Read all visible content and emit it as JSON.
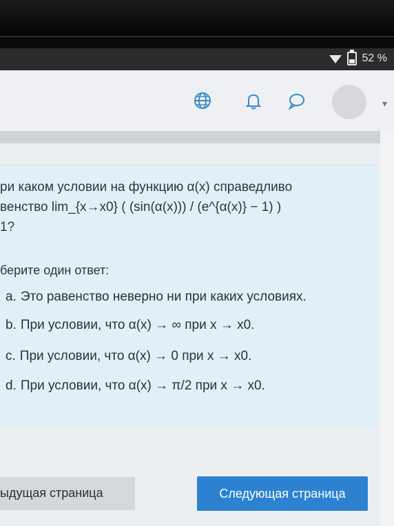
{
  "status_bar": {
    "battery_text": "52 %"
  },
  "header": {
    "icons": [
      "globe-icon",
      "bell-icon",
      "chat-icon",
      "avatar",
      "chevron-down-icon"
    ]
  },
  "question": {
    "lines": [
      "ри каком условии на функцию α(x) справедливо",
      "венство lim_{x→x0} ( (sin(α(x))) / (e^{α(x)} − 1) )",
      "1?"
    ],
    "prompt": "берите один ответ:",
    "options": [
      {
        "letter": "a.",
        "text": "Это равенство неверно ни при каких условиях."
      },
      {
        "letter": "b.",
        "text": "При условии, что α(x) → ∞ при x → x0."
      },
      {
        "letter": "c.",
        "text": "При условии, что α(x) → 0 при x → x0."
      },
      {
        "letter": "d.",
        "text": "При условии, что α(x) → π/2 при x → x0."
      }
    ]
  },
  "navigation": {
    "prev_label": "ыдущая страница",
    "next_label": "Следующая страница"
  },
  "colors": {
    "accent": "#2c82d0",
    "question_bg": "#e1f0f7"
  }
}
